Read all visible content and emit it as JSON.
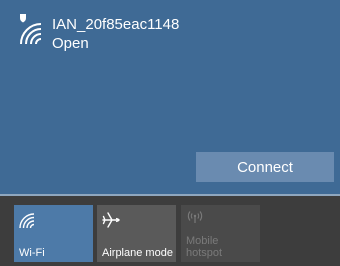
{
  "network": {
    "name": "IAN_20f85eac1148",
    "status": "Open",
    "connect_label": "Connect"
  },
  "quick_actions": [
    {
      "label": "Wi-Fi",
      "icon": "wifi-icon",
      "active": true,
      "enabled": true
    },
    {
      "label": "Airplane mode",
      "icon": "airplane-icon",
      "active": false,
      "enabled": true
    },
    {
      "label_line1": "Mobile",
      "label_line2": "hotspot",
      "icon": "hotspot-icon",
      "active": false,
      "enabled": false
    }
  ],
  "colors": {
    "panel_background": "#3f6a95",
    "connect_button": "#6a8bb0",
    "wifi_tile_active": "#4d7aa8",
    "tile_inactive": "#5a5a5a",
    "tile_disabled": "#4a4a4a",
    "taskbar_background": "#3d3d3d"
  }
}
